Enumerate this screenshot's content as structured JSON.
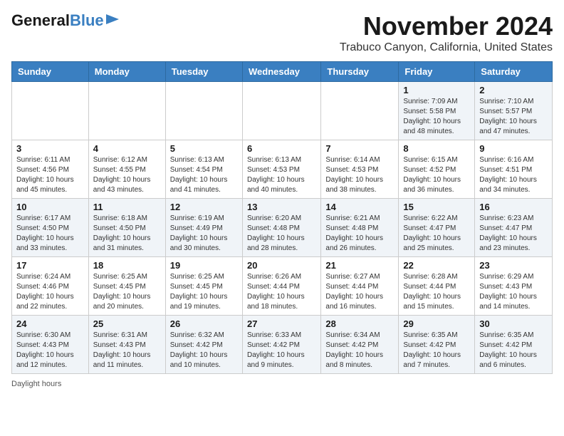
{
  "header": {
    "logo_general": "General",
    "logo_blue": "Blue",
    "month_title": "November 2024",
    "location": "Trabuco Canyon, California, United States"
  },
  "weekdays": [
    "Sunday",
    "Monday",
    "Tuesday",
    "Wednesday",
    "Thursday",
    "Friday",
    "Saturday"
  ],
  "footer": {
    "daylight_label": "Daylight hours"
  },
  "weeks": [
    [
      {
        "day": "",
        "info": ""
      },
      {
        "day": "",
        "info": ""
      },
      {
        "day": "",
        "info": ""
      },
      {
        "day": "",
        "info": ""
      },
      {
        "day": "",
        "info": ""
      },
      {
        "day": "1",
        "info": "Sunrise: 7:09 AM\nSunset: 5:58 PM\nDaylight: 10 hours\nand 48 minutes."
      },
      {
        "day": "2",
        "info": "Sunrise: 7:10 AM\nSunset: 5:57 PM\nDaylight: 10 hours\nand 47 minutes."
      }
    ],
    [
      {
        "day": "3",
        "info": "Sunrise: 6:11 AM\nSunset: 4:56 PM\nDaylight: 10 hours\nand 45 minutes."
      },
      {
        "day": "4",
        "info": "Sunrise: 6:12 AM\nSunset: 4:55 PM\nDaylight: 10 hours\nand 43 minutes."
      },
      {
        "day": "5",
        "info": "Sunrise: 6:13 AM\nSunset: 4:54 PM\nDaylight: 10 hours\nand 41 minutes."
      },
      {
        "day": "6",
        "info": "Sunrise: 6:13 AM\nSunset: 4:53 PM\nDaylight: 10 hours\nand 40 minutes."
      },
      {
        "day": "7",
        "info": "Sunrise: 6:14 AM\nSunset: 4:53 PM\nDaylight: 10 hours\nand 38 minutes."
      },
      {
        "day": "8",
        "info": "Sunrise: 6:15 AM\nSunset: 4:52 PM\nDaylight: 10 hours\nand 36 minutes."
      },
      {
        "day": "9",
        "info": "Sunrise: 6:16 AM\nSunset: 4:51 PM\nDaylight: 10 hours\nand 34 minutes."
      }
    ],
    [
      {
        "day": "10",
        "info": "Sunrise: 6:17 AM\nSunset: 4:50 PM\nDaylight: 10 hours\nand 33 minutes."
      },
      {
        "day": "11",
        "info": "Sunrise: 6:18 AM\nSunset: 4:50 PM\nDaylight: 10 hours\nand 31 minutes."
      },
      {
        "day": "12",
        "info": "Sunrise: 6:19 AM\nSunset: 4:49 PM\nDaylight: 10 hours\nand 30 minutes."
      },
      {
        "day": "13",
        "info": "Sunrise: 6:20 AM\nSunset: 4:48 PM\nDaylight: 10 hours\nand 28 minutes."
      },
      {
        "day": "14",
        "info": "Sunrise: 6:21 AM\nSunset: 4:48 PM\nDaylight: 10 hours\nand 26 minutes."
      },
      {
        "day": "15",
        "info": "Sunrise: 6:22 AM\nSunset: 4:47 PM\nDaylight: 10 hours\nand 25 minutes."
      },
      {
        "day": "16",
        "info": "Sunrise: 6:23 AM\nSunset: 4:47 PM\nDaylight: 10 hours\nand 23 minutes."
      }
    ],
    [
      {
        "day": "17",
        "info": "Sunrise: 6:24 AM\nSunset: 4:46 PM\nDaylight: 10 hours\nand 22 minutes."
      },
      {
        "day": "18",
        "info": "Sunrise: 6:25 AM\nSunset: 4:45 PM\nDaylight: 10 hours\nand 20 minutes."
      },
      {
        "day": "19",
        "info": "Sunrise: 6:25 AM\nSunset: 4:45 PM\nDaylight: 10 hours\nand 19 minutes."
      },
      {
        "day": "20",
        "info": "Sunrise: 6:26 AM\nSunset: 4:44 PM\nDaylight: 10 hours\nand 18 minutes."
      },
      {
        "day": "21",
        "info": "Sunrise: 6:27 AM\nSunset: 4:44 PM\nDaylight: 10 hours\nand 16 minutes."
      },
      {
        "day": "22",
        "info": "Sunrise: 6:28 AM\nSunset: 4:44 PM\nDaylight: 10 hours\nand 15 minutes."
      },
      {
        "day": "23",
        "info": "Sunrise: 6:29 AM\nSunset: 4:43 PM\nDaylight: 10 hours\nand 14 minutes."
      }
    ],
    [
      {
        "day": "24",
        "info": "Sunrise: 6:30 AM\nSunset: 4:43 PM\nDaylight: 10 hours\nand 12 minutes."
      },
      {
        "day": "25",
        "info": "Sunrise: 6:31 AM\nSunset: 4:43 PM\nDaylight: 10 hours\nand 11 minutes."
      },
      {
        "day": "26",
        "info": "Sunrise: 6:32 AM\nSunset: 4:42 PM\nDaylight: 10 hours\nand 10 minutes."
      },
      {
        "day": "27",
        "info": "Sunrise: 6:33 AM\nSunset: 4:42 PM\nDaylight: 10 hours\nand 9 minutes."
      },
      {
        "day": "28",
        "info": "Sunrise: 6:34 AM\nSunset: 4:42 PM\nDaylight: 10 hours\nand 8 minutes."
      },
      {
        "day": "29",
        "info": "Sunrise: 6:35 AM\nSunset: 4:42 PM\nDaylight: 10 hours\nand 7 minutes."
      },
      {
        "day": "30",
        "info": "Sunrise: 6:35 AM\nSunset: 4:42 PM\nDaylight: 10 hours\nand 6 minutes."
      }
    ]
  ]
}
